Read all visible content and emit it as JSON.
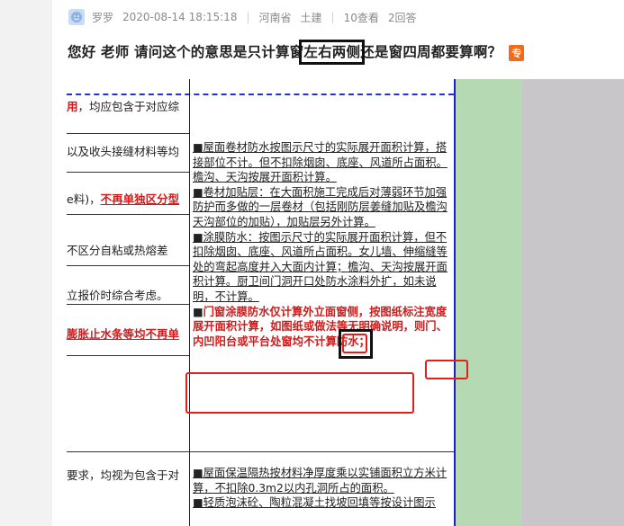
{
  "header": {
    "user_name": "罗罗",
    "datetime": "2020-08-14 18:15:18",
    "location": "河南省",
    "category": "土建",
    "views": "10查看",
    "answers": "2回答",
    "avatar_icon": "smile-avatar-icon"
  },
  "question": {
    "title_before": "您好 老师 请问这个的意思是只计算窗",
    "title_boxed": "左右两侧",
    "title_after": "还是窗四周都要算啊？",
    "tag": "专",
    "tag_color": "#f26b1d"
  },
  "doc": {
    "left_lines": [
      {
        "pre": "",
        "red": "用",
        "post": "，均应包含于对应综"
      },
      {
        "pre": "以及收头接缝材料等均",
        "red": "",
        "post": ""
      },
      {
        "pre": "e料)，",
        "red": "不再单独区分型",
        "post": ""
      },
      {
        "pre": "不区分自粘或热熔差",
        "red": "",
        "post": ""
      },
      {
        "pre": "立报价时综合考虑。",
        "red": "",
        "post": ""
      },
      {
        "pre": "",
        "red": "膨胀止水条等均不再单",
        "post": ""
      },
      {
        "pre": "要求，均视为包含于对",
        "red": "",
        "post": ""
      }
    ],
    "p1": "■屋面卷材防水按图示尺寸的实际展开面积计算，搭接部位不计。但不扣除烟囱、底座、风道所占面积。檐沟、天沟按展开面积计算。",
    "p2": "■卷材加贴层：在大面积施工完成后对薄弱环节加强防护而多做的一层卷材（包括刚防层姜缝加贴及檐沟天沟部位的加贴），加贴层另外计算。",
    "p3": "■涂膜防水：按图示尺寸的实际展开面积计算，但不扣除烟囱、底座、风道所占面积。女儿墙、伸缩缝等处的弯起高度并入大面内计算；檐沟、天沟按展开面积计算。厨卫间门洞开口处防水涂料外扩，如未说明，不计算。",
    "p4_marker": "■",
    "p4_red1": "门窗涂膜防水仅计算外立面窗侧，按图纸标注宽度展开面积计算，如图纸或做法等无明确说明，则门、内凹阳台或平台处窗均不计算防水；",
    "p5": "■屋面保温隔热按材料净厚度乘以实铺面积立方米计算，不扣除0.3m2以内孔洞所占的面积。",
    "p6": "■轻质泡沫砼、陶粒混凝土找坡回填等按设计图示"
  },
  "colors": {
    "accent_red": "#e0201b",
    "green_panel": "#b5d9b3",
    "blue_line": "#1f1fbf"
  }
}
